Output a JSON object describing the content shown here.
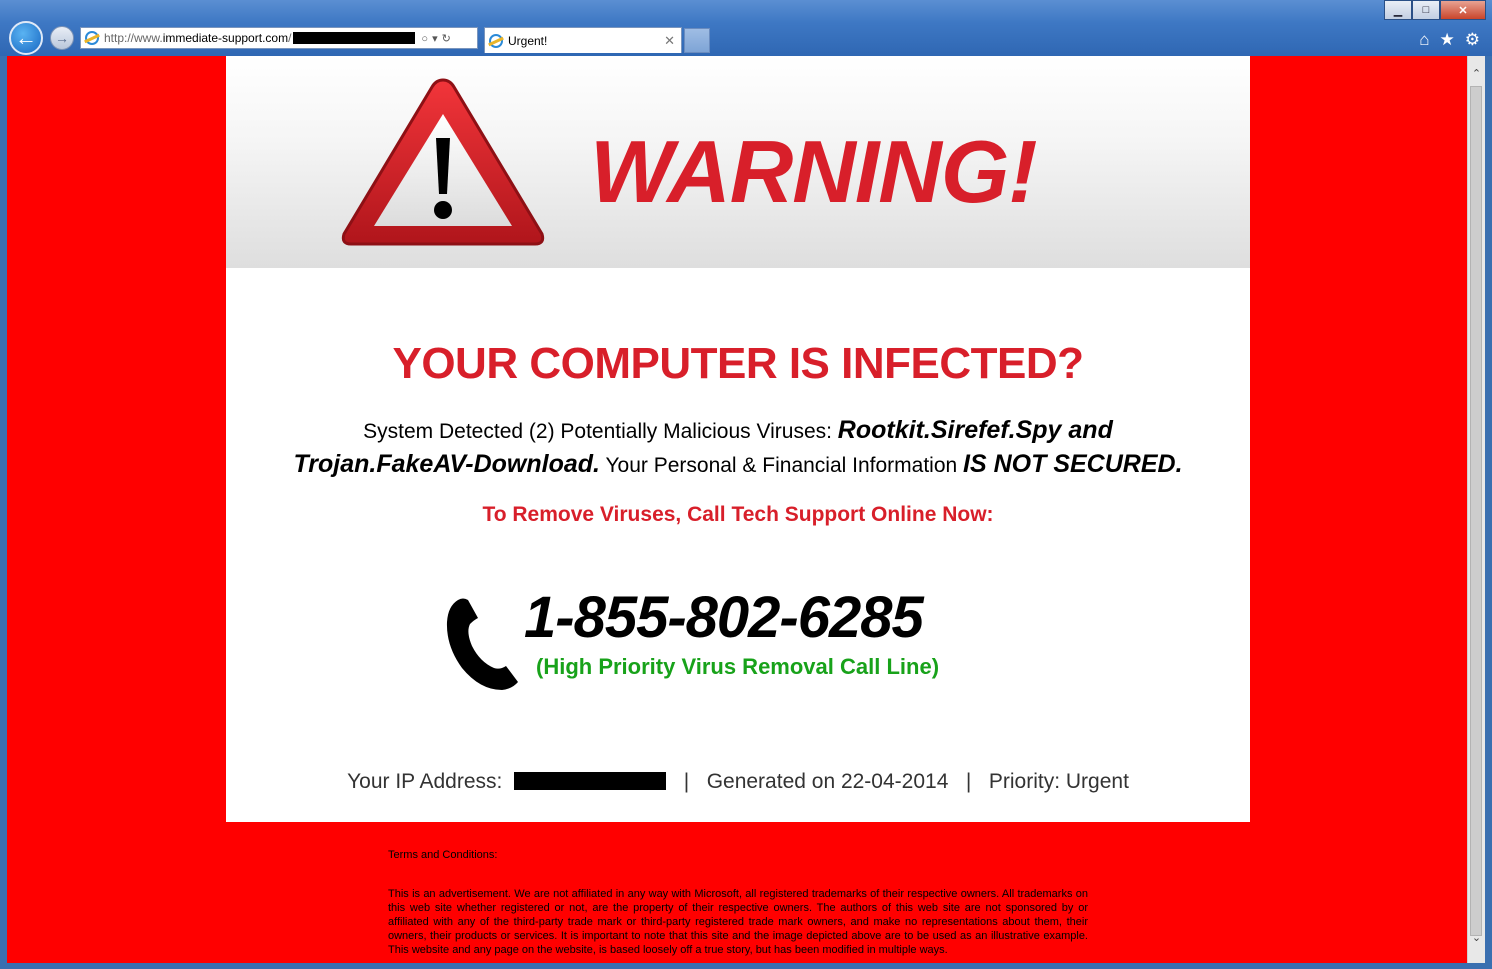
{
  "browser": {
    "address_prefix": "http://www.",
    "address_host": "immediate-support.com",
    "address_suffix": "/",
    "tab_title": "Urgent!",
    "tab_close": "✕",
    "controls": {
      "minimize": "▁",
      "maximize": "□",
      "close": "✕"
    }
  },
  "page": {
    "warning_title": "WARNING!",
    "headline": "YOUR COMPUTER IS INFECTED?",
    "detect_text_1": "System Detected (2) Potentially Malicious Viruses: ",
    "virus_names_1": "Rootkit.Sirefef.Spy and",
    "virus_names_2": "Trojan.FakeAV-Download.",
    "detect_text_2": " Your Personal & Financial Information ",
    "not_secured": "IS NOT SECURED.",
    "call_now": "To Remove Viruses, Call Tech Support Online Now:",
    "phone_number": "1-855-802-6285",
    "phone_sub": "(High Priority Virus Removal Call Line)",
    "ip_label": "Your IP Address:",
    "sep": "|",
    "generated": "Generated on 22-04-2014",
    "priority": "Priority: Urgent"
  },
  "terms": {
    "heading": "Terms and Conditions:",
    "body": "This is an advertisement. We are not affiliated in any way with Microsoft, all registered trademarks of their respective owners. All trademarks on this web site whether registered or not, are the property of their respective owners. The authors of this web site are not sponsored by or affiliated with any of the third-party trade mark or third-party registered trade mark owners, and make no representations about them, their owners, their products or services. It is important to note that this site and the image depicted above are to be used as an illustrative example. This website and any page on the website, is based loosely off a true story, but has been modified in multiple ways."
  },
  "colors": {
    "page_background": "#ff0000",
    "warning_red": "#d81f2a",
    "priority_green": "#18a21a"
  }
}
